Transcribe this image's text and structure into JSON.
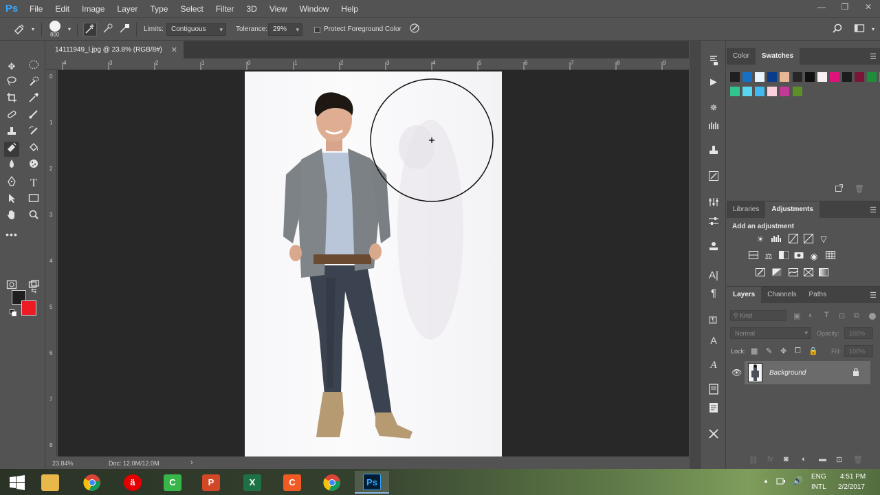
{
  "app": {
    "logo": "Ps",
    "menu": [
      "File",
      "Edit",
      "Image",
      "Layer",
      "Type",
      "Select",
      "Filter",
      "3D",
      "View",
      "Window",
      "Help"
    ],
    "window_controls": [
      "—",
      "❐",
      "✕"
    ]
  },
  "options_bar": {
    "brush_size": "800",
    "limits_label": "Limits:",
    "limits_value": "Contiguous",
    "tolerance_label": "Tolerance:",
    "tolerance_value": "29%",
    "protect_label": "Protect Foreground Color",
    "protect_checked": false
  },
  "document": {
    "tab_title": "14111949_l.jpg @ 23.8% (RGB/8#)",
    "close_glyph": "✕",
    "zoom": "23.84%",
    "doc_info": "Doc: 12.0M/12.0M",
    "status_arrow": "›"
  },
  "rulers": {
    "top": [
      "4",
      "3",
      "2",
      "1",
      "0",
      "1",
      "2",
      "3",
      "4",
      "5",
      "6",
      "7",
      "8",
      "9"
    ],
    "left": [
      "0",
      "1",
      "2",
      "3",
      "4",
      "5",
      "6",
      "7",
      "8"
    ]
  },
  "colors": {
    "foreground": "#202020",
    "background": "#ed1c24",
    "accent": "#31a8ff"
  },
  "swatches_panel": {
    "tabs": [
      "Color",
      "Swatches"
    ],
    "active_tab": "Swatches",
    "menu_glyph": "☰",
    "row1": [
      "#1f1f1f",
      "#1570c6",
      "#e8f4fc",
      "#0a3c8c",
      "#e8b896",
      "#262626",
      "#101010",
      "#f8f1f4",
      "#e0127b",
      "#1c1c1c",
      "#7a1537",
      "#1f8e3a",
      "#6a9c2e",
      "#c02868",
      "#f6c6d8"
    ],
    "row2": [
      "#31c48e",
      "#58d7f0",
      "#40b8f0",
      "#fbd0dc",
      "#c23a95",
      "#5c8f28"
    ]
  },
  "adjustments_panel": {
    "tabs": [
      "Libraries",
      "Adjustments"
    ],
    "active_tab": "Adjustments",
    "heading": "Add an adjustment",
    "menu_glyph": "☰"
  },
  "layers_panel": {
    "tabs": [
      "Layers",
      "Channels",
      "Paths"
    ],
    "active_tab": "Layers",
    "menu_glyph": "☰",
    "filter_placeholder": "Kind",
    "blend_mode": "Normal",
    "opacity_label": "Opacity:",
    "opacity_value": "100%",
    "lock_label": "Lock:",
    "fill_label": "Fill:",
    "fill_value": "100%",
    "layers": [
      {
        "name": "Background",
        "visible": true,
        "locked": true
      }
    ]
  },
  "taskbar": {
    "apps": [
      "Windows Start",
      "File Explorer",
      "Google Chrome",
      "Airtel",
      "Camtasia",
      "PowerPoint",
      "Excel",
      "Camtasia Recorder",
      "Google Chrome",
      "Photoshop"
    ],
    "language": "ENG",
    "layout": "INTL",
    "time": "4:51 PM",
    "date": "2/2/2017",
    "tray_arrow": "▲"
  }
}
